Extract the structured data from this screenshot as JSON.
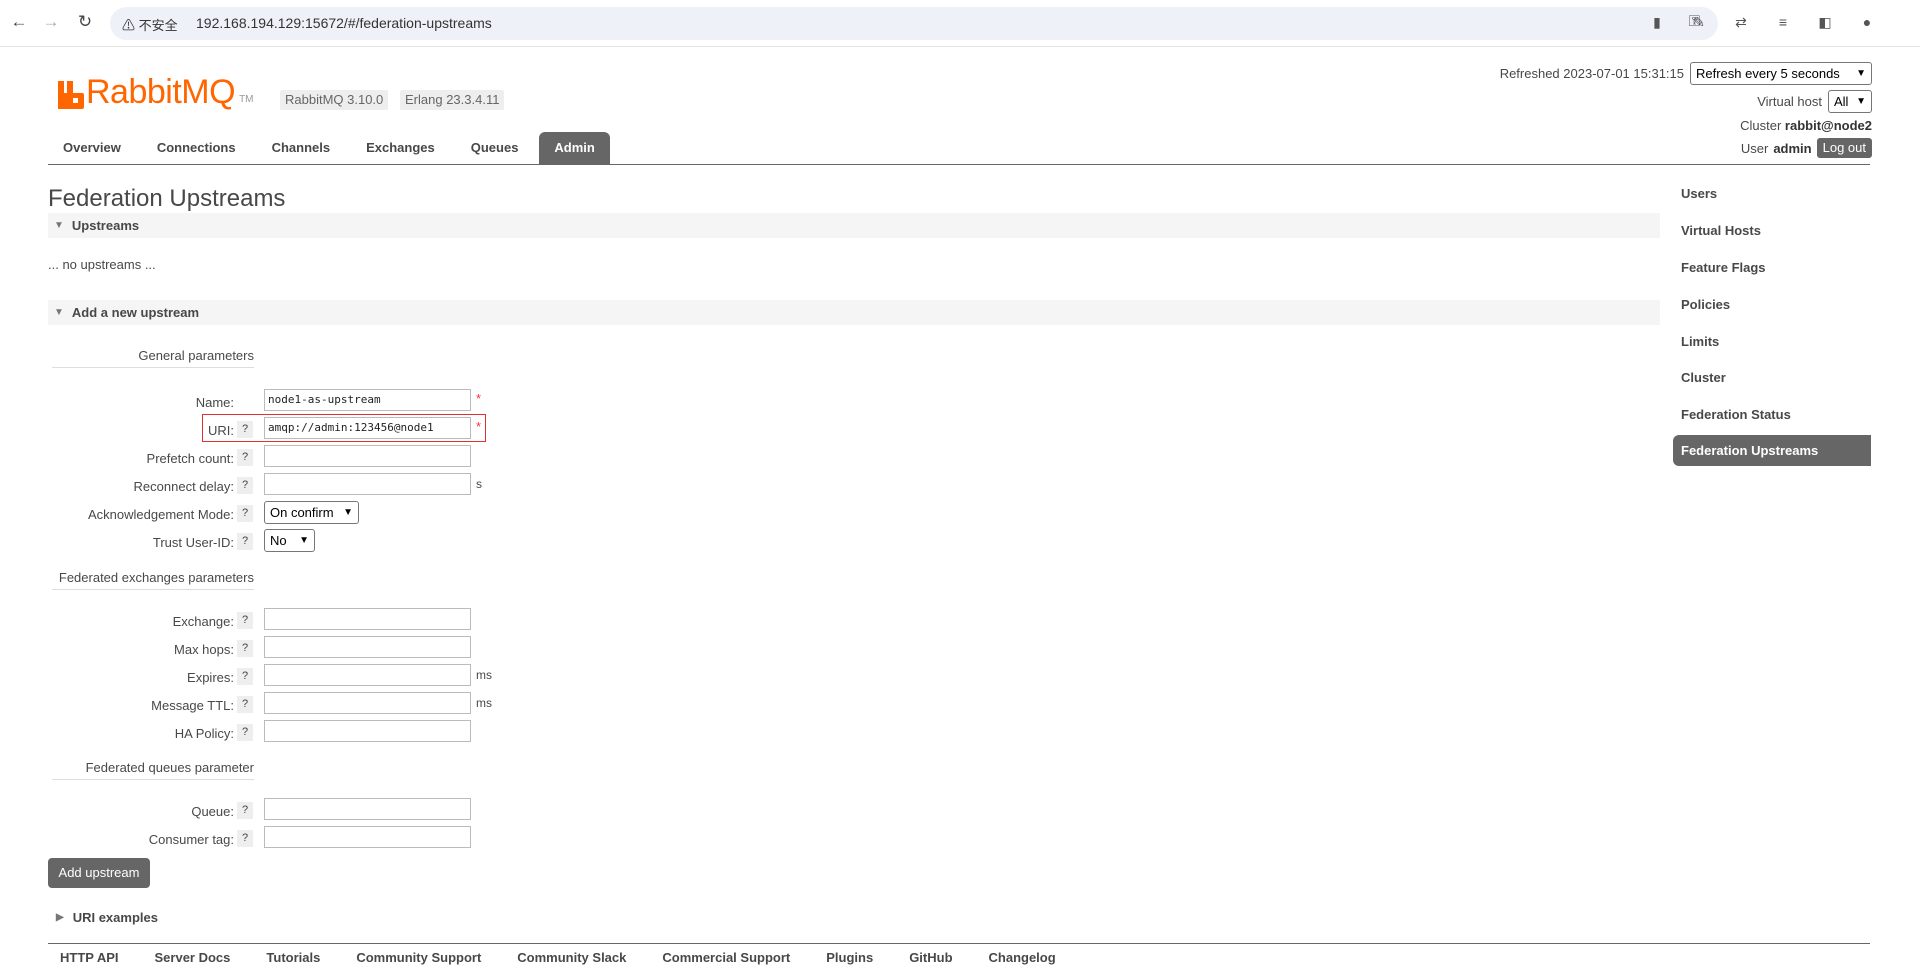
{
  "browser": {
    "back_icon": "←",
    "forward_icon": "→",
    "reload_icon": "↻",
    "security_label": "⚠ 不安全",
    "url": "192.168.194.129:15672/#/federation-upstreams"
  },
  "header": {
    "logo_text": "RabbitMQ",
    "logo_tm": "TM",
    "version": "RabbitMQ 3.10.0",
    "erlang": "Erlang 23.3.4.11",
    "refreshed_label": "Refreshed 2023-07-01 15:31:15",
    "refresh_select": "Refresh every 5 seconds",
    "vhost_label": "Virtual host",
    "vhost_select": "All",
    "cluster_label": "Cluster",
    "cluster_value": "rabbit@node2",
    "user_label": "User",
    "user_value": "admin",
    "logout": "Log out"
  },
  "tabs": [
    "Overview",
    "Connections",
    "Channels",
    "Exchanges",
    "Queues",
    "Admin"
  ],
  "page": {
    "title": "Federation Upstreams",
    "upstreams_section": "Upstreams",
    "no_upstreams": "... no upstreams ...",
    "add_section": "Add a new upstream",
    "general_group": "General parameters",
    "exchanges_group": "Federated exchanges parameters",
    "queues_group": "Federated queues parameter",
    "required_mark": "*",
    "help_mark": "?",
    "unit_s": "s",
    "unit_ms": "ms",
    "fields": {
      "name_label": "Name:",
      "name_value": "node1-as-upstream",
      "uri_label": "URI:",
      "uri_value": "amqp://admin:123456@node1",
      "prefetch_label": "Prefetch count:",
      "reconnect_label": "Reconnect delay:",
      "ack_label": "Acknowledgement Mode:",
      "ack_value": "On confirm",
      "trust_label": "Trust User-ID:",
      "trust_value": "No",
      "exchange_label": "Exchange:",
      "maxhops_label": "Max hops:",
      "expires_label": "Expires:",
      "ttl_label": "Message TTL:",
      "ha_label": "HA Policy:",
      "queue_label": "Queue:",
      "consumer_label": "Consumer tag:"
    },
    "add_button": "Add upstream",
    "uri_examples": "URI examples"
  },
  "sidebar": [
    "Users",
    "Virtual Hosts",
    "Feature Flags",
    "Policies",
    "Limits",
    "Cluster",
    "Federation Status",
    "Federation Upstreams"
  ],
  "footer": [
    "HTTP API",
    "Server Docs",
    "Tutorials",
    "Community Support",
    "Community Slack",
    "Commercial Support",
    "Plugins",
    "GitHub",
    "Changelog"
  ],
  "colors": {
    "brand": "#ff6600",
    "active_tab": "#666666",
    "highlight": "#e03030"
  }
}
